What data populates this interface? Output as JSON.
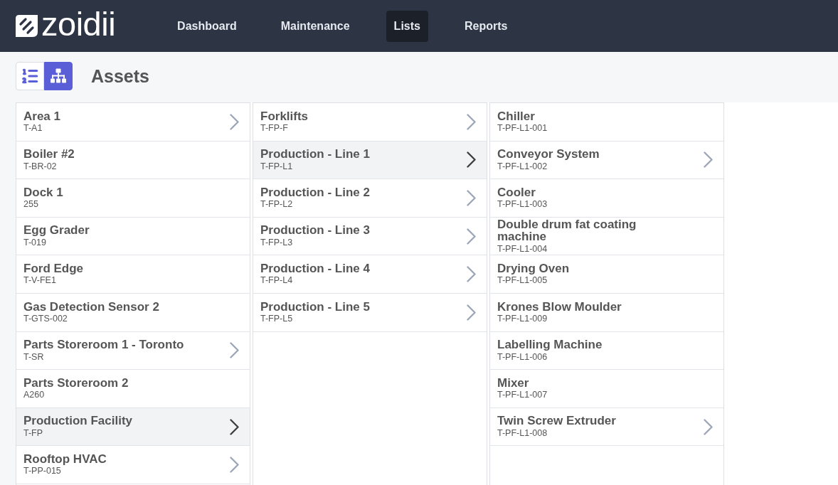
{
  "header": {
    "logo": {
      "text": "zoidii"
    },
    "nav": [
      {
        "label": "Dashboard",
        "selected": false
      },
      {
        "label": "Maintenance",
        "selected": false
      },
      {
        "label": "Lists",
        "selected": true
      },
      {
        "label": "Reports",
        "selected": false
      }
    ]
  },
  "toolbar": {
    "views": [
      {
        "kind": "list",
        "selected": false
      },
      {
        "kind": "tree",
        "selected": true
      }
    ],
    "title": "Assets"
  },
  "columns": [
    {
      "items": [
        {
          "name": "Area 1",
          "code": "T-A1",
          "has_children": true,
          "selected": false
        },
        {
          "name": "Boiler #2",
          "code": "T-BR-02",
          "has_children": false,
          "selected": false
        },
        {
          "name": "Dock 1",
          "code": "255",
          "has_children": false,
          "selected": false
        },
        {
          "name": "Egg Grader",
          "code": "T-019",
          "has_children": false,
          "selected": false
        },
        {
          "name": "Ford Edge",
          "code": "T-V-FE1",
          "has_children": false,
          "selected": false
        },
        {
          "name": "Gas Detection Sensor 2",
          "code": "T-GTS-002",
          "has_children": false,
          "selected": false
        },
        {
          "name": "Parts Storeroom 1 - Toronto",
          "code": "T-SR",
          "has_children": true,
          "selected": false
        },
        {
          "name": "Parts Storeroom 2",
          "code": "A260",
          "has_children": false,
          "selected": false
        },
        {
          "name": "Production Facility",
          "code": "T-FP",
          "has_children": true,
          "selected": true
        },
        {
          "name": "Rooftop HVAC",
          "code": "T-PP-015",
          "has_children": true,
          "selected": false
        }
      ]
    },
    {
      "items": [
        {
          "name": "Forklifts",
          "code": "T-FP-F",
          "has_children": true,
          "selected": false
        },
        {
          "name": "Production - Line 1",
          "code": "T-FP-L1",
          "has_children": true,
          "selected": true
        },
        {
          "name": "Production - Line 2",
          "code": "T-FP-L2",
          "has_children": true,
          "selected": false
        },
        {
          "name": "Production - Line 3",
          "code": "T-FP-L3",
          "has_children": true,
          "selected": false
        },
        {
          "name": "Production - Line 4",
          "code": "T-FP-L4",
          "has_children": true,
          "selected": false
        },
        {
          "name": "Production - Line 5",
          "code": "T-FP-L5",
          "has_children": true,
          "selected": false
        }
      ]
    },
    {
      "items": [
        {
          "name": "Chiller",
          "code": "T-PF-L1-001",
          "has_children": false,
          "selected": false
        },
        {
          "name": "Conveyor System",
          "code": "T-PF-L1-002",
          "has_children": true,
          "selected": false
        },
        {
          "name": "Cooler",
          "code": "T-PF-L1-003",
          "has_children": false,
          "selected": false
        },
        {
          "name": "Double drum fat coating machine",
          "code": "T-PF-L1-004",
          "has_children": false,
          "selected": false
        },
        {
          "name": "Drying Oven",
          "code": "T-PF-L1-005",
          "has_children": false,
          "selected": false
        },
        {
          "name": "Krones Blow Moulder",
          "code": "T-PF-L1-009",
          "has_children": false,
          "selected": false
        },
        {
          "name": "Labelling Machine",
          "code": "T-PF-L1-006",
          "has_children": false,
          "selected": false
        },
        {
          "name": "Mixer",
          "code": "T-PF-L1-007",
          "has_children": false,
          "selected": false
        },
        {
          "name": "Twin Screw Extruder",
          "code": "T-PF-L1-008",
          "has_children": true,
          "selected": false
        }
      ]
    }
  ]
}
